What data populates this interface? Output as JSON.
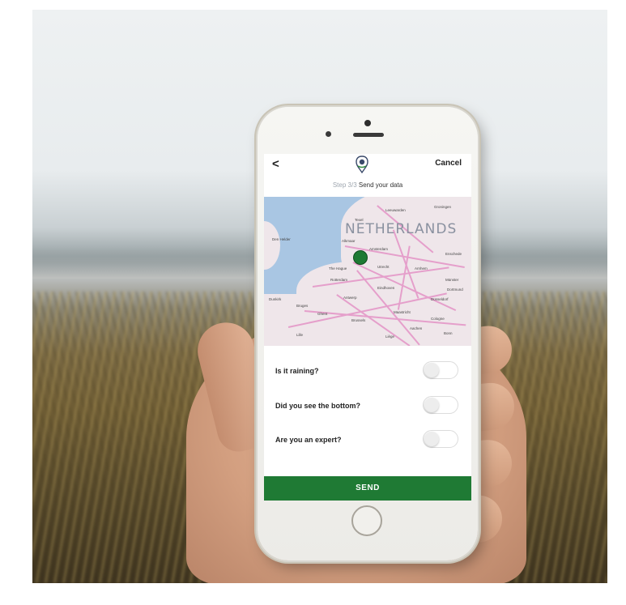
{
  "nav": {
    "back": "<",
    "cancel": "Cancel",
    "logo_icon": "app-logo-icon"
  },
  "step": {
    "number": "Step 3/3",
    "title": "Send your data"
  },
  "map": {
    "country_label": "NETHERLANDS",
    "marker_color": "#1e7a34",
    "cities": [
      "Leeuwarden",
      "Groningen",
      "Texel",
      "Den Helder",
      "Alkmaar",
      "Amsterdam",
      "The Hague",
      "Utrecht",
      "Arnhem",
      "Rotterdam",
      "Eindhoven",
      "Antwerp",
      "Brussels",
      "Dunkirk",
      "Lille",
      "Maastricht",
      "Düsseldorf",
      "Cologne",
      "Bonn",
      "Liège",
      "Münster",
      "Enschede",
      "Aachen",
      "Dortmund",
      "Bruges",
      "Ghent"
    ]
  },
  "questions": [
    {
      "label": "Is it raining?",
      "on": false
    },
    {
      "label": "Did you see the bottom?",
      "on": false
    },
    {
      "label": "Are you an expert?",
      "on": false
    }
  ],
  "send": {
    "label": "SEND",
    "color": "#1f7a34"
  }
}
